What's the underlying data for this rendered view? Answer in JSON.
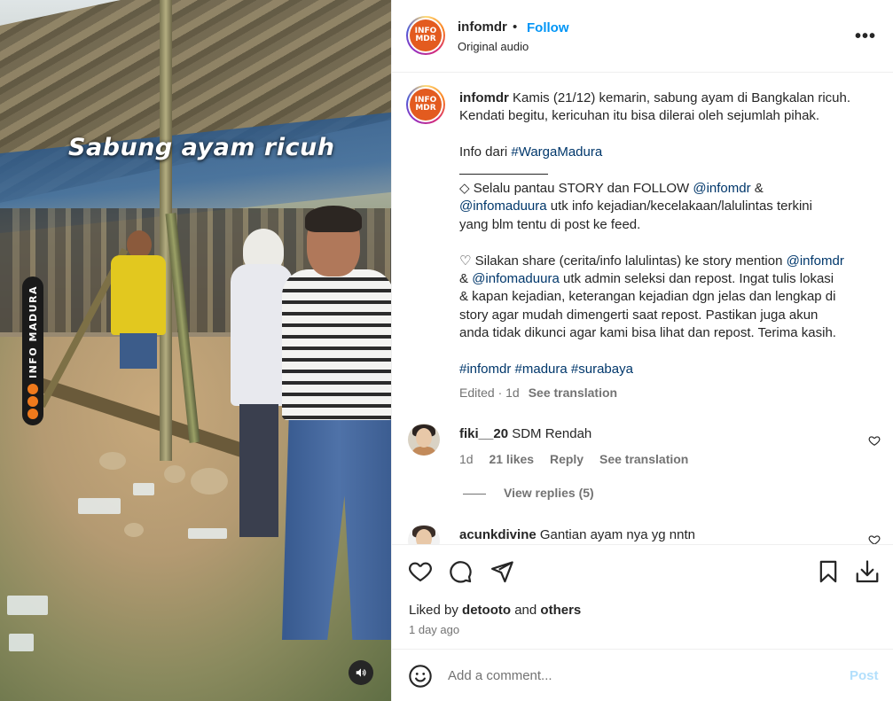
{
  "media": {
    "overlay_text": "Sabung ayam ricuh",
    "watermark": "INFO MADURA",
    "audio_icon": "speaker-icon"
  },
  "header": {
    "username": "infomdr",
    "separator": "•",
    "follow_label": "Follow",
    "subtitle": "Original audio",
    "more_icon": "•••",
    "avatar_text": "INFO MDR"
  },
  "caption": {
    "username": "infomdr",
    "text_1": "Kamis (21/12) kemarin, sabung ayam di Bangkalan ricuh.",
    "text_2": "Kendati begitu, kericuhan itu bisa dilerai oleh sejumlah pihak.",
    "info_prefix": "Info dari ",
    "info_tag": "#WargaMadura",
    "p2_a": "◇ Selalu pantau STORY dan FOLLOW ",
    "p2_mention1": "@infomdr",
    "p2_b": " &",
    "p2_mention2": "@infomaduura",
    "p2_c": " utk info kejadian/kecelakaan/lalulintas terkini",
    "p2_d": "yang blm tentu di post ke feed.",
    "p3_a": "♡ Silakan share (cerita/info lalulintas) ke story mention ",
    "p3_mention1": "@infomdr",
    "p3_b": "& ",
    "p3_mention2": "@infomaduura",
    "p3_c": " utk admin seleksi dan repost. Ingat tulis lokasi",
    "p3_d": "& kapan kejadian, keterangan kejadian dgn jelas dan lengkap di",
    "p3_e": "story agar mudah dimengerti saat repost. Pastikan juga akun",
    "p3_f": "anda tidak dikunci agar kami bisa lihat dan repost. Terima kasih.",
    "tags": [
      "#infomdr",
      "#madura",
      "#surabaya"
    ],
    "edited": "Edited · 1d",
    "see_translation": "See translation"
  },
  "comments": [
    {
      "username": "fiki__20",
      "text": "SDM Rendah",
      "age": "1d",
      "likes": "21 likes",
      "reply": "Reply",
      "see_translation": "See translation",
      "view_replies": "View replies (5)"
    },
    {
      "username": "acunkdivine",
      "text": "Gantian ayam nya yg nntn"
    }
  ],
  "actions": {
    "liked_by_prefix": "Liked by ",
    "liked_by_user": "detooto",
    "liked_by_mid": " and ",
    "liked_by_others": "others",
    "time": "1 day ago"
  },
  "comment_bar": {
    "placeholder": "Add a comment...",
    "post_label": "Post"
  }
}
